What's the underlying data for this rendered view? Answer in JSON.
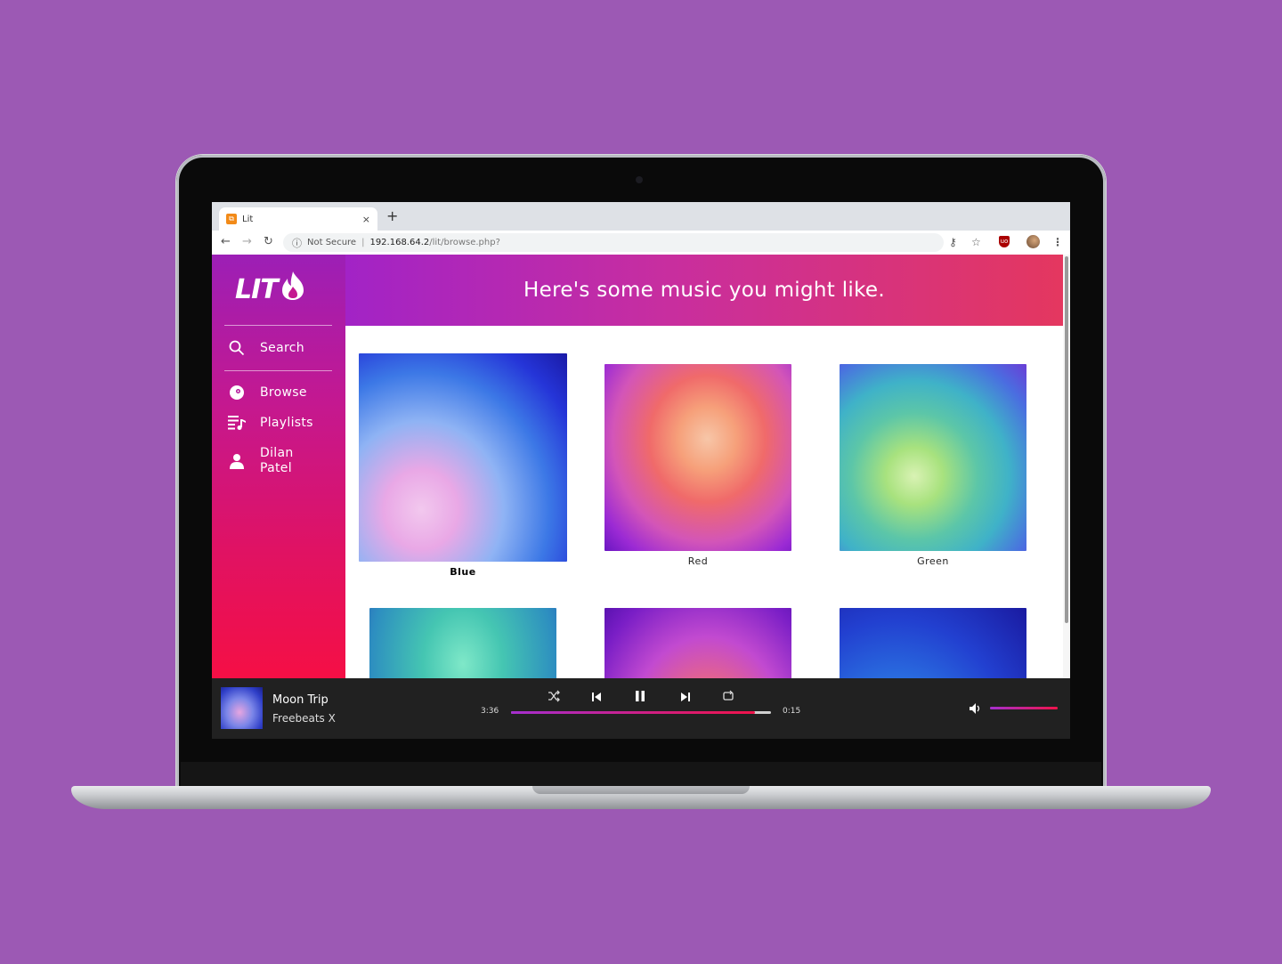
{
  "browser": {
    "tab_title": "Lit",
    "tab_favicon": "lit-favicon",
    "new_tab": "+",
    "close": "×",
    "security_label": "Not Secure",
    "url_host": "192.168.64.2",
    "url_path": "/lit/browse.php?"
  },
  "sidebar": {
    "logo": "LIT",
    "items": [
      {
        "label": "Search",
        "icon": "search-icon"
      },
      {
        "label": "Browse",
        "icon": "disc-icon"
      },
      {
        "label": "Playlists",
        "icon": "playlist-icon"
      },
      {
        "label": "Dilan Patel",
        "icon": "user-icon"
      }
    ]
  },
  "main": {
    "banner": "Here's some music you might like.",
    "albums": [
      {
        "label": "Blue"
      },
      {
        "label": "Red"
      },
      {
        "label": "Green"
      },
      {
        "label": ""
      },
      {
        "label": ""
      },
      {
        "label": ""
      }
    ]
  },
  "player": {
    "title": "Moon Trip",
    "artist": "Freebeats X",
    "elapsed": "3:36",
    "remaining": "0:15",
    "progress": 0.94,
    "volume": 1.0
  },
  "colors": {
    "accent_start": "#a52fcf",
    "accent_end": "#f0134a",
    "page_bg": "#9c59b4"
  }
}
